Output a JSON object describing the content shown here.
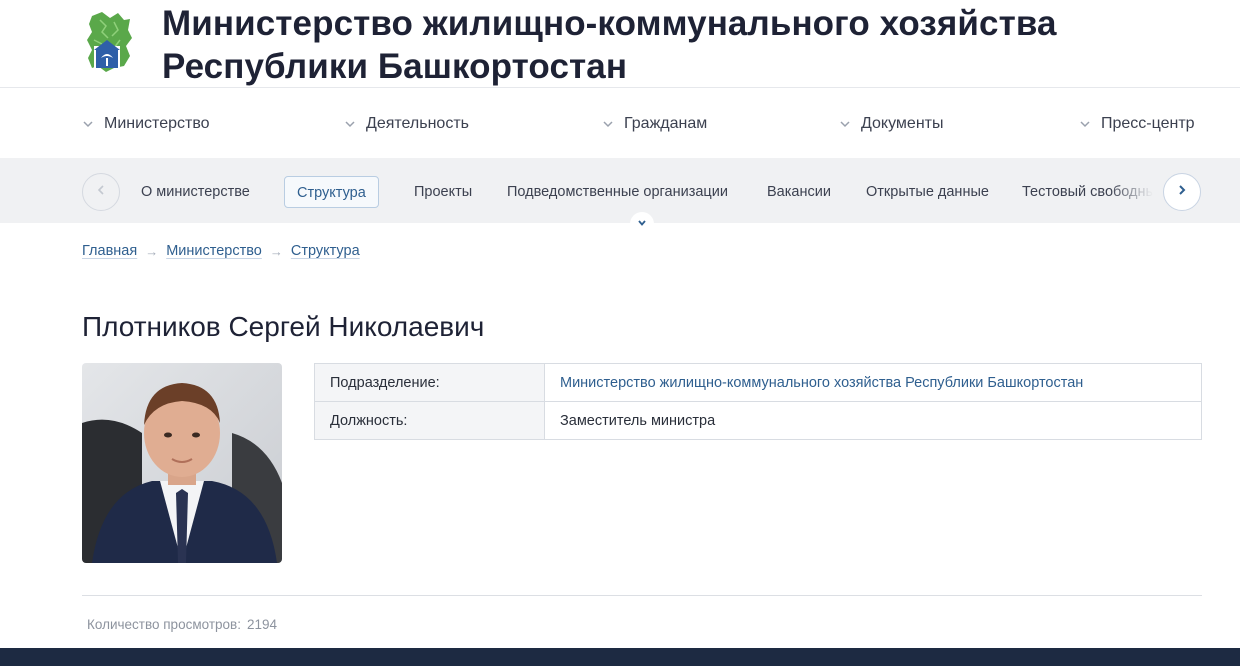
{
  "header": {
    "title_line1": "Министерство жилищно-коммунального хозяйства",
    "title_line2": "Республики Башкортостан",
    "logo_icon": "bashkortostan-map-emblem-icon"
  },
  "main_nav": {
    "items": [
      {
        "label": "Министерство"
      },
      {
        "label": "Деятельность"
      },
      {
        "label": "Гражданам"
      },
      {
        "label": "Документы"
      },
      {
        "label": "Пресс-центр"
      }
    ]
  },
  "sub_nav": {
    "items": [
      {
        "label": "О министерстве",
        "active": false
      },
      {
        "label": "Структура",
        "active": true
      },
      {
        "label": "Проекты",
        "active": false
      },
      {
        "label": "Подведомственные организации",
        "active": false
      },
      {
        "label": "Вакансии",
        "active": false
      },
      {
        "label": "Открытые данные",
        "active": false
      },
      {
        "label": "Тестовый свободны",
        "active": false
      }
    ]
  },
  "breadcrumb": [
    "Главная",
    "Министерство",
    "Структура"
  ],
  "person": {
    "name": "Плотников Сергей Николаевич",
    "rows": [
      {
        "label": "Подразделение:",
        "value": "Министерство жилищно-коммунального хозяйства Республики Башкортостан"
      },
      {
        "label": "Должность:",
        "value": "Заместитель министра"
      }
    ]
  },
  "views": {
    "label": "Количество просмотров:",
    "count": "2194"
  },
  "colors": {
    "accent_link": "#2f5f8f",
    "footer": "#1d2a42",
    "subnav_bg": "#f0f1f3"
  }
}
